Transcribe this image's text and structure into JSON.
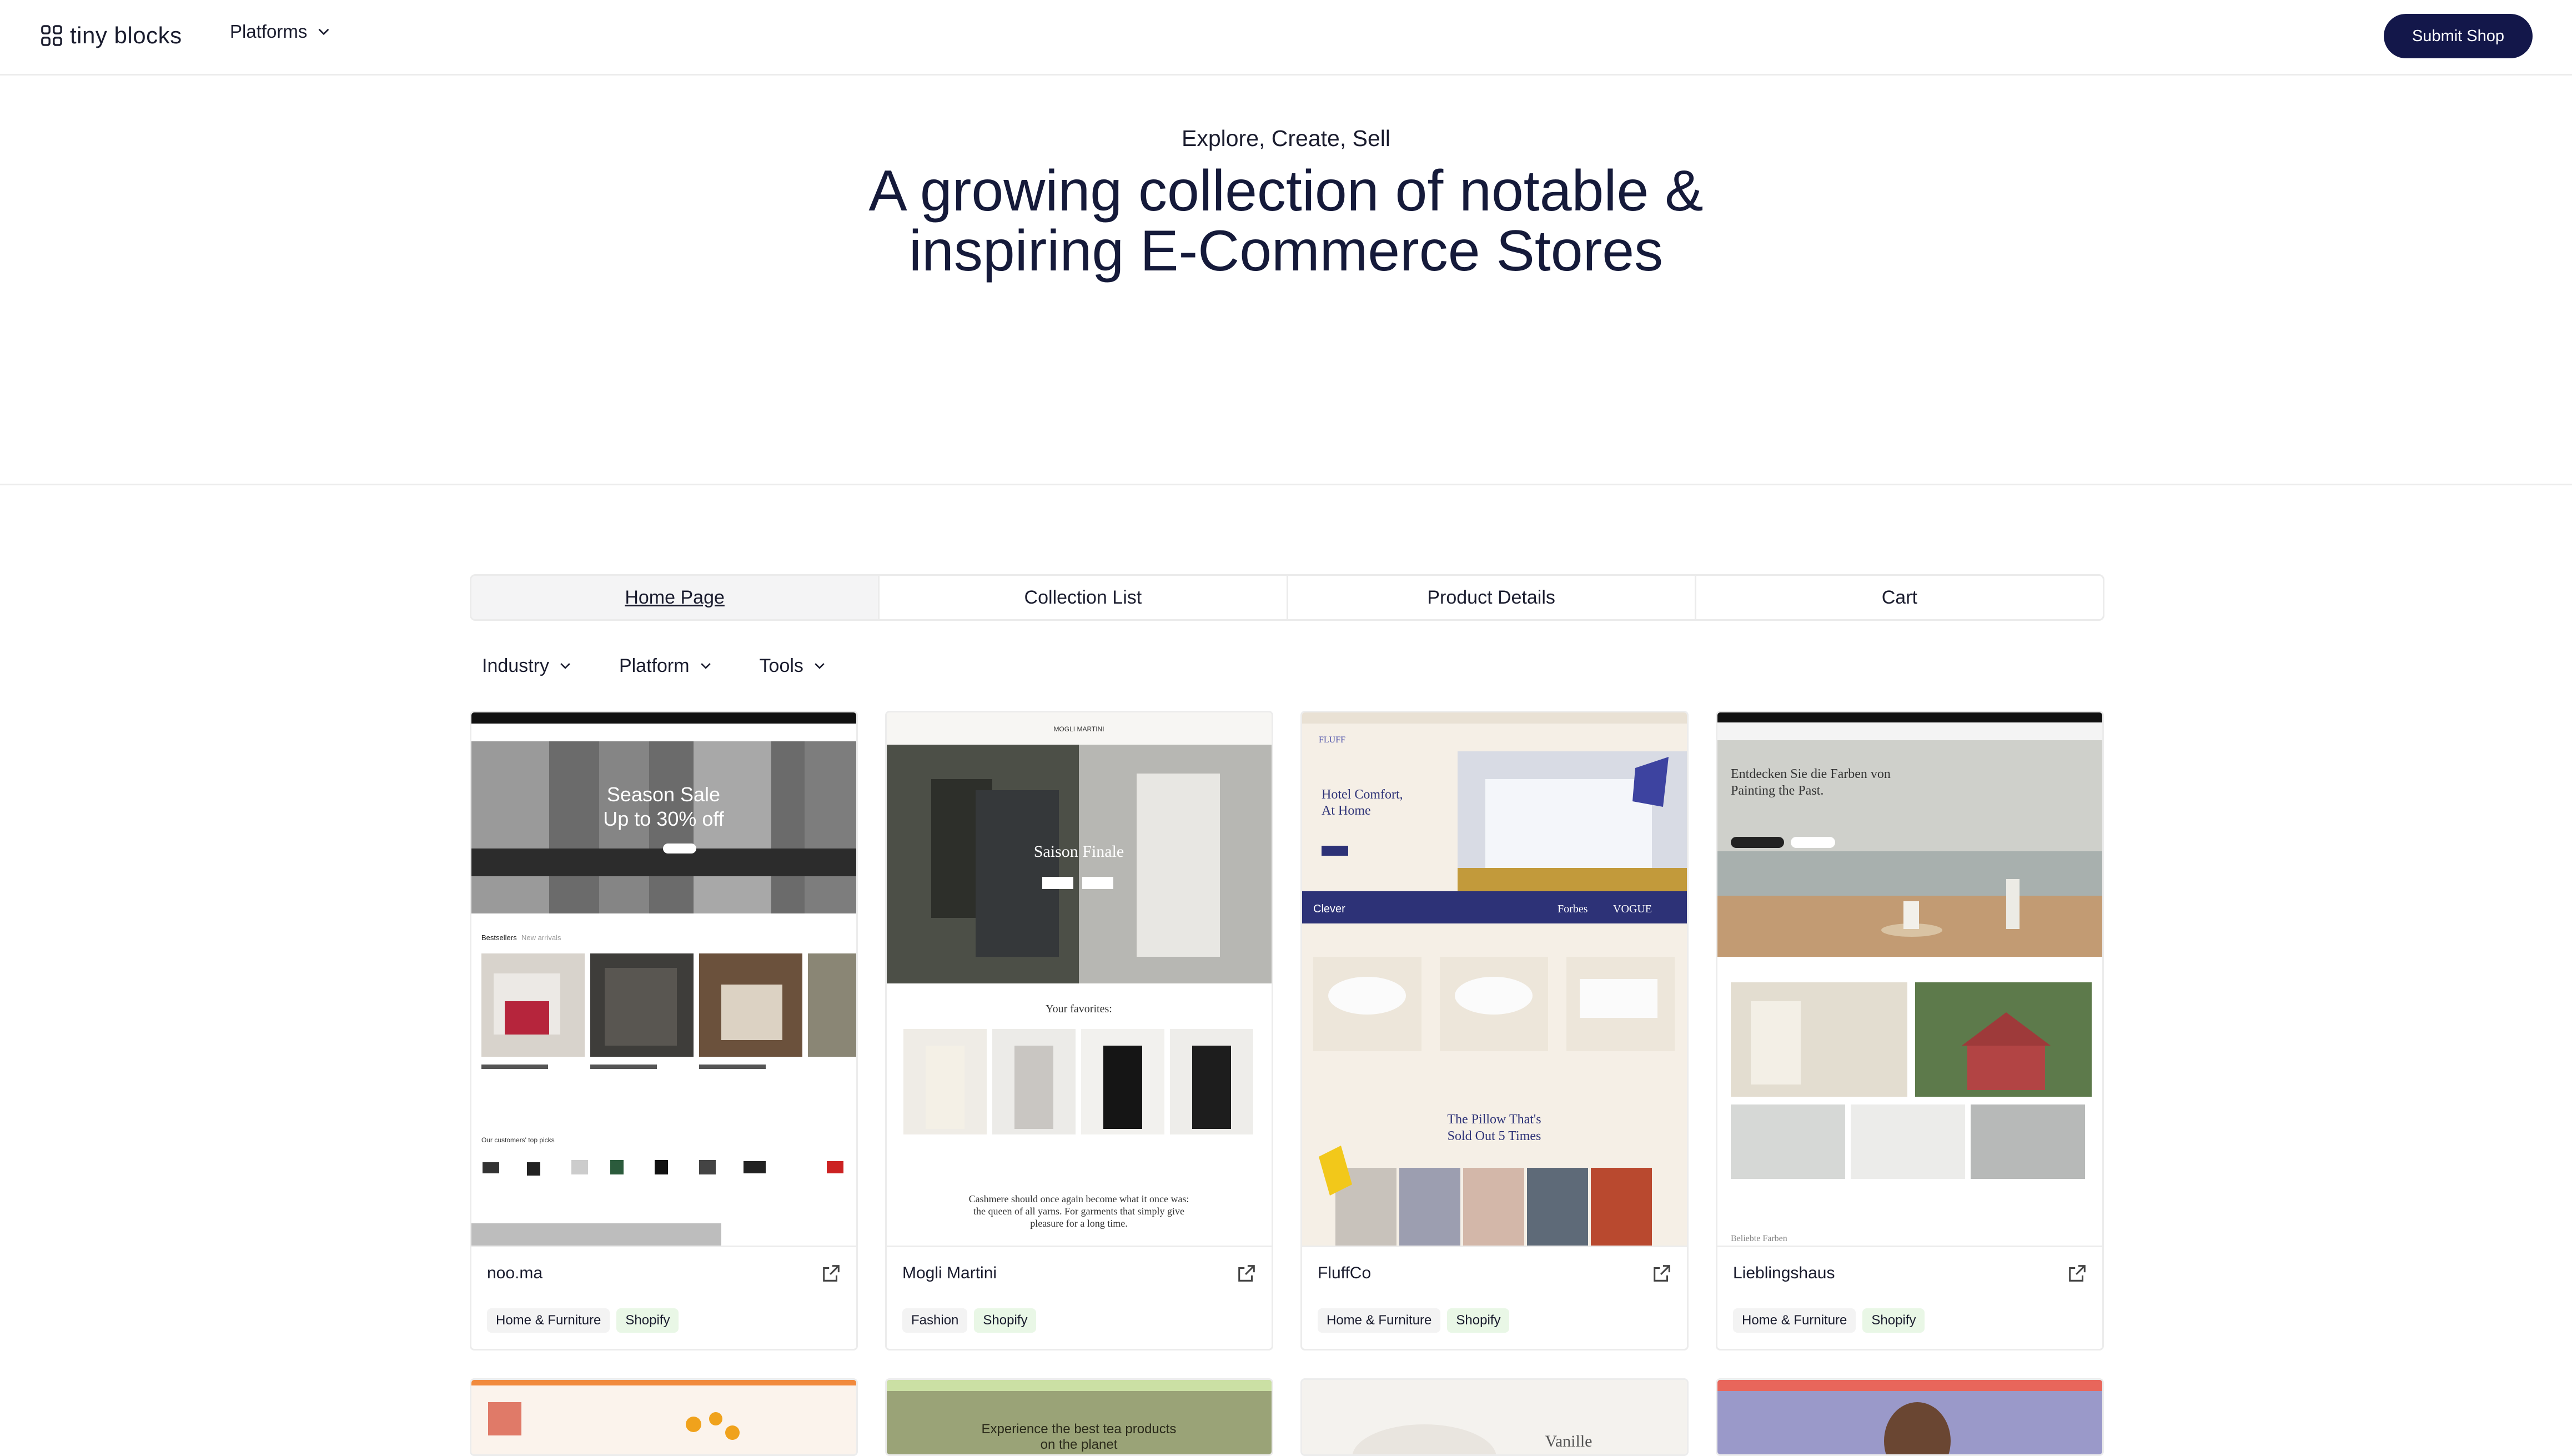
{
  "header": {
    "brand": "tiny blocks",
    "nav_platforms": "Platforms",
    "submit_label": "Submit Shop"
  },
  "hero": {
    "subtitle": "Explore, Create, Sell",
    "title_line1": "A growing collection of notable &",
    "title_line2": "inspiring E-Commerce Stores"
  },
  "tabs": [
    {
      "label": "Home Page",
      "active": true
    },
    {
      "label": "Collection List",
      "active": false
    },
    {
      "label": "Product Details",
      "active": false
    },
    {
      "label": "Cart",
      "active": false
    }
  ],
  "filters": [
    "Industry",
    "Platform",
    "Tools"
  ],
  "cards": [
    {
      "name": "noo.ma",
      "industry": "Home & Furniture",
      "platform": "Shopify",
      "shot": {
        "banner_line1": "Season Sale",
        "banner_line2": "Up to 30% off",
        "section": "Bestsellers",
        "section_sub": "New arrivals",
        "picks": "Our customers' top picks"
      }
    },
    {
      "name": "Mogli Martini",
      "industry": "Fashion",
      "platform": "Shopify",
      "shot": {
        "logo": "MOGLI MARTINI",
        "hero": "Saison Finale",
        "favorites": "Your favorites:",
        "quote_1": "Cashmere should once again become what it once was:",
        "quote_2": "the queen of all yarns. For garments that simply give",
        "quote_3": "pleasure for a long time."
      }
    },
    {
      "name": "FluffCo",
      "industry": "Home & Furniture",
      "platform": "Shopify",
      "shot": {
        "logo": "FLUFF",
        "hero_1": "Hotel Comfort,",
        "hero_2": "At Home",
        "press_1": "Clever",
        "press_2": "Forbes",
        "press_3": "VOGUE",
        "promo_1": "The Pillow That's",
        "promo_2": "Sold Out 5 Times"
      }
    },
    {
      "name": "Lieblingshaus",
      "industry": "Home & Furniture",
      "platform": "Shopify",
      "shot": {
        "hero_1": "Entdecken Sie die Farben von",
        "hero_2": "Painting the Past.",
        "footer": "Beliebte Farben"
      }
    }
  ],
  "next_row": {
    "tea": "Experience the best tea products",
    "tea2": "on the planet",
    "vanille": "Vanille"
  },
  "colors": {
    "primary": "#13174a",
    "tag_green": "#e9f7e6",
    "tag_grey": "#f3f3f3"
  }
}
